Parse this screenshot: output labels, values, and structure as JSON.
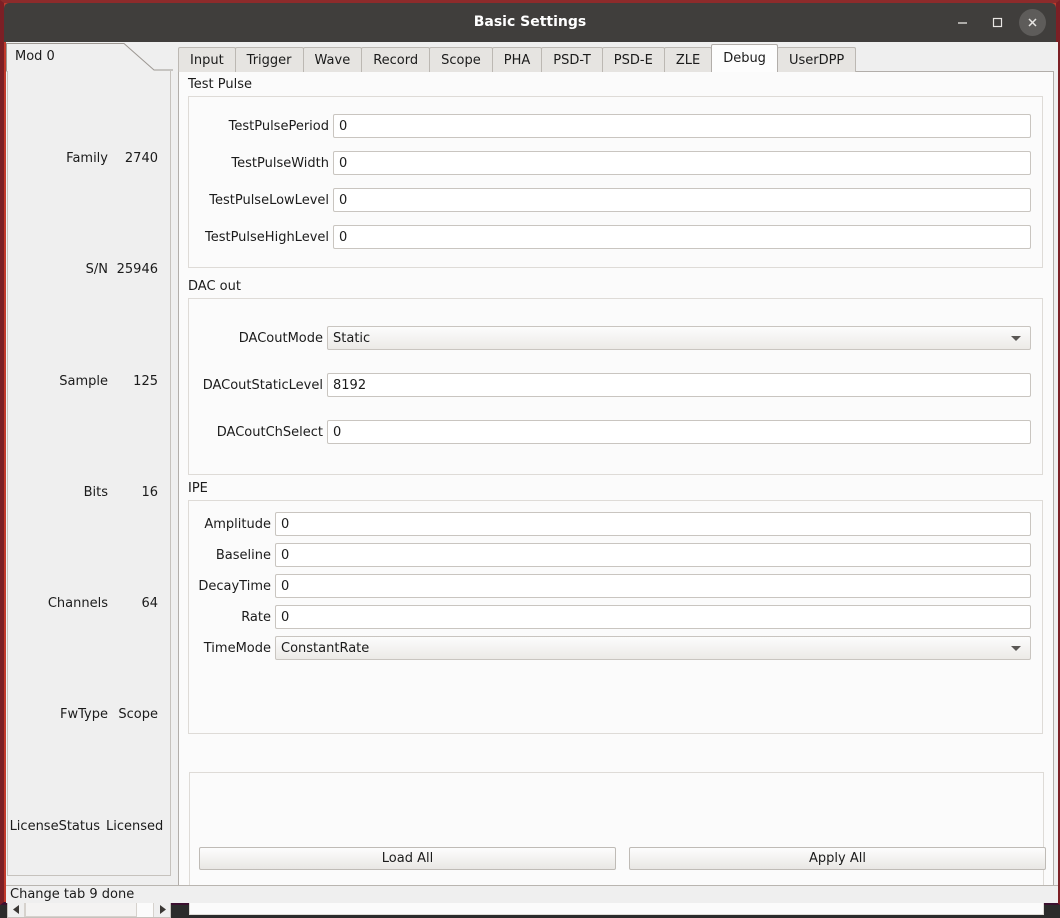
{
  "window": {
    "title": "Basic Settings",
    "controls": {
      "minimize": "minimize-icon",
      "maximize": "maximize-icon",
      "close": "close-icon"
    },
    "accent_border": "#7c1f25",
    "titlebar_color": "#403e3c"
  },
  "module_panel": {
    "tab_label": "Mod 0",
    "rows": [
      {
        "key": "Family",
        "value": "2740"
      },
      {
        "key": "S/N",
        "value": "25946"
      },
      {
        "key": "Sample",
        "value": "125"
      },
      {
        "key": "Bits",
        "value": "16"
      },
      {
        "key": "Channels",
        "value": "64"
      },
      {
        "key": "FwType",
        "value": "Scope"
      },
      {
        "key": "LicenseStatus",
        "value": "Licensed"
      }
    ],
    "scrollbar": {
      "left_arrow": "caret-left-icon",
      "right_arrow": "caret-right-icon"
    }
  },
  "tabs": [
    {
      "label": "Input",
      "selected": false
    },
    {
      "label": "Trigger",
      "selected": false
    },
    {
      "label": "Wave",
      "selected": false
    },
    {
      "label": "Record",
      "selected": false
    },
    {
      "label": "Scope",
      "selected": false
    },
    {
      "label": "PHA",
      "selected": false
    },
    {
      "label": "PSD-T",
      "selected": false
    },
    {
      "label": "PSD-E",
      "selected": false
    },
    {
      "label": "ZLE",
      "selected": false
    },
    {
      "label": "Debug",
      "selected": true
    },
    {
      "label": "UserDPP",
      "selected": false
    }
  ],
  "groups": {
    "test_pulse": {
      "title": "Test Pulse",
      "fields": [
        {
          "label": "TestPulsePeriod",
          "value": "0",
          "type": "text"
        },
        {
          "label": "TestPulseWidth",
          "value": "0",
          "type": "text"
        },
        {
          "label": "TestPulseLowLevel",
          "value": "0",
          "type": "text"
        },
        {
          "label": "TestPulseHighLevel",
          "value": "0",
          "type": "text"
        }
      ]
    },
    "dac_out": {
      "title": "DAC out",
      "fields": [
        {
          "label": "DACoutMode",
          "value": "Static",
          "type": "combo"
        },
        {
          "label": "DACoutStaticLevel",
          "value": "8192",
          "type": "text"
        },
        {
          "label": "DACoutChSelect",
          "value": "0",
          "type": "text"
        }
      ]
    },
    "ipe": {
      "title": "IPE",
      "fields": [
        {
          "label": "Amplitude",
          "value": "0",
          "type": "text"
        },
        {
          "label": "Baseline",
          "value": "0",
          "type": "text"
        },
        {
          "label": "DecayTime",
          "value": "0",
          "type": "text"
        },
        {
          "label": "Rate",
          "value": "0",
          "type": "text"
        },
        {
          "label": "TimeMode",
          "value": "ConstantRate",
          "type": "combo"
        }
      ]
    }
  },
  "actions": {
    "load_all": "Load All",
    "apply_all": "Apply All"
  },
  "statusbar": {
    "message": "Change tab 9 done"
  }
}
